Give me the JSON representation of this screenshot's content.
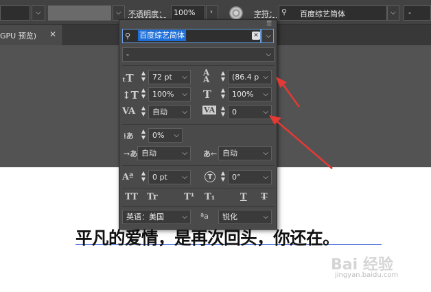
{
  "control_bar": {
    "opacity_label": "不透明度：",
    "opacity_value": "100%",
    "character_label": "字符：",
    "font_value": "百度综艺简体",
    "size_value": "-"
  },
  "document_tab": {
    "label": "GPU 预览)"
  },
  "panel": {
    "font_family": "百度综艺简体",
    "font_style": "-",
    "font_size": "72 pt",
    "leading": "(86.4 p",
    "vertical_scale": "100%",
    "horizontal_scale": "100%",
    "kerning": "自动",
    "tracking": "0",
    "tsume": "0%",
    "aki_left": "自动",
    "aki_right": "自动",
    "baseline_shift": "0 pt",
    "rotation": "0°",
    "style_buttons": [
      "TT",
      "Tr",
      "T¹",
      "T₁",
      "T",
      "T"
    ],
    "language": "英语：美国",
    "aa_glyph": "ªa",
    "antialias": "锐化"
  },
  "artboard": {
    "text": "平凡的爱情，是再次回头，你还在。"
  },
  "watermark": {
    "brand": "Bai 经验",
    "url": "jingyan.baidu.com"
  },
  "colors": {
    "arrow": "#e53935",
    "selection": "#1e6fd9",
    "baseline": "#3a63d6"
  }
}
